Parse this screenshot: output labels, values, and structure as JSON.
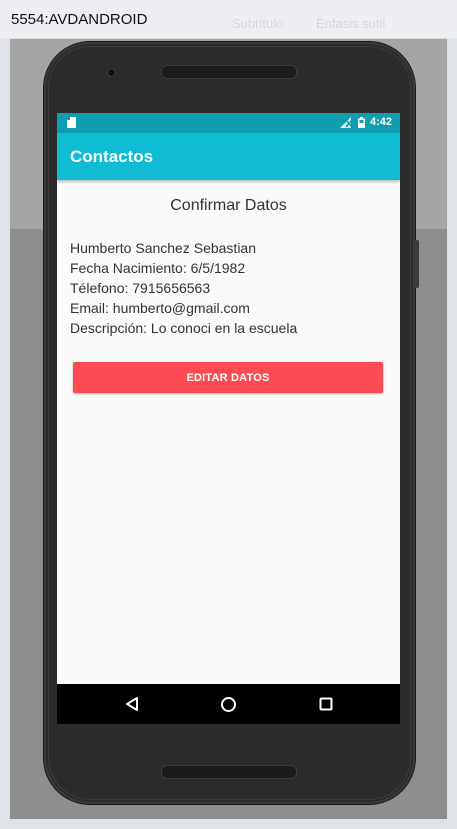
{
  "window": {
    "title": "5554:AVDANDROID",
    "background_menu": [
      "Subtítulo",
      "Énfasis sutil"
    ]
  },
  "status_bar": {
    "time": "4:42",
    "icons": [
      "sd-card-icon",
      "signal-off-icon",
      "battery-icon"
    ]
  },
  "app_bar": {
    "title": "Contactos"
  },
  "content": {
    "heading": "Confirmar Datos",
    "lines": [
      "Humberto Sanchez Sebastian",
      "Fecha Nacimiento: 6/5/1982",
      "Télefono: 7915656563",
      "Email: humberto@gmail.com",
      "Descripción: Lo conoci en la escuela"
    ],
    "edit_button_label": "EDITAR DATOS"
  },
  "nav_bar": {
    "buttons": [
      "back-icon",
      "home-icon",
      "recents-icon"
    ]
  },
  "colors": {
    "status_bar": "#0f9db0",
    "app_bar": "#0fbcd4",
    "button": "#fc4b53"
  }
}
